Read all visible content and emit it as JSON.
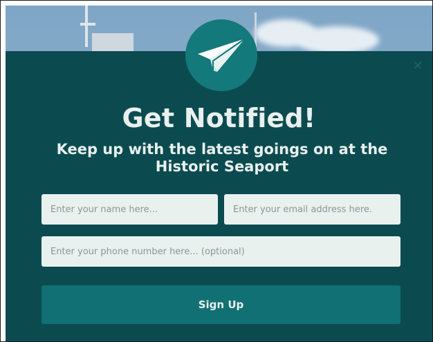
{
  "popup": {
    "icon": "paper-plane-icon",
    "close_icon": "close-icon",
    "title": "Get Notified!",
    "subtitle": "Keep up with the latest goings on at the Historic Seaport",
    "fields": {
      "name": {
        "placeholder": "Enter your name here...",
        "value": ""
      },
      "email": {
        "placeholder": "Enter your email address here.",
        "value": ""
      },
      "phone": {
        "placeholder": "Enter your phone number here... (optional)",
        "value": ""
      }
    },
    "submit_label": "Sign Up",
    "colors": {
      "panel": "#0b4b50",
      "accent": "#13797b",
      "button": "#117073",
      "input_bg": "#e9f1ef",
      "text": "#e9f0ee"
    }
  }
}
